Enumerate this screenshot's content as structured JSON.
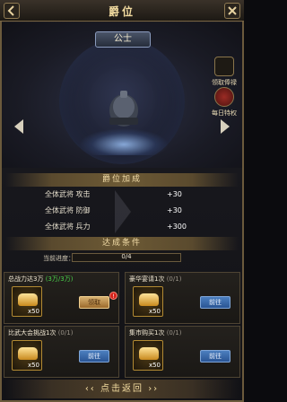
{
  "header": {
    "title": "爵位"
  },
  "rank": {
    "name": "公士"
  },
  "side_buttons": [
    {
      "label": "领取俸禄",
      "icon": "salary-icon"
    },
    {
      "label": "每日特权",
      "icon": "privilege-icon"
    }
  ],
  "bonus": {
    "title": "爵位加成",
    "rows": [
      {
        "label": "全体武将 攻击",
        "value": "+30"
      },
      {
        "label": "全体武将 防御",
        "value": "+30"
      },
      {
        "label": "全体武将 兵力",
        "value": "+300"
      }
    ]
  },
  "conditions": {
    "title": "达成条件",
    "progress_label": "当前进度：",
    "progress_text": "0/4",
    "progress_value": 0,
    "cards": [
      {
        "title": "总战力达3万",
        "progress": "(3万/3万)",
        "reward_qty": "x50",
        "button": "领取",
        "button_type": "claim",
        "badge": "!"
      },
      {
        "title": "豪华宴请1次",
        "progress": "(0/1)",
        "reward_qty": "x50",
        "button": "前往",
        "button_type": "go"
      },
      {
        "title": "比武大会挑战1次",
        "progress": "(0/1)",
        "reward_qty": "x50",
        "button": "前往",
        "button_type": "go"
      },
      {
        "title": "集市购买1次",
        "progress": "(0/1)",
        "reward_qty": "x50",
        "button": "前往",
        "button_type": "go"
      }
    ]
  },
  "footer": {
    "return_label": "点击返回"
  },
  "colors": {
    "gold": "#f3dca0",
    "claim": "#d8b271",
    "go": "#4c7fbf",
    "progress_green": "#49d04a"
  }
}
